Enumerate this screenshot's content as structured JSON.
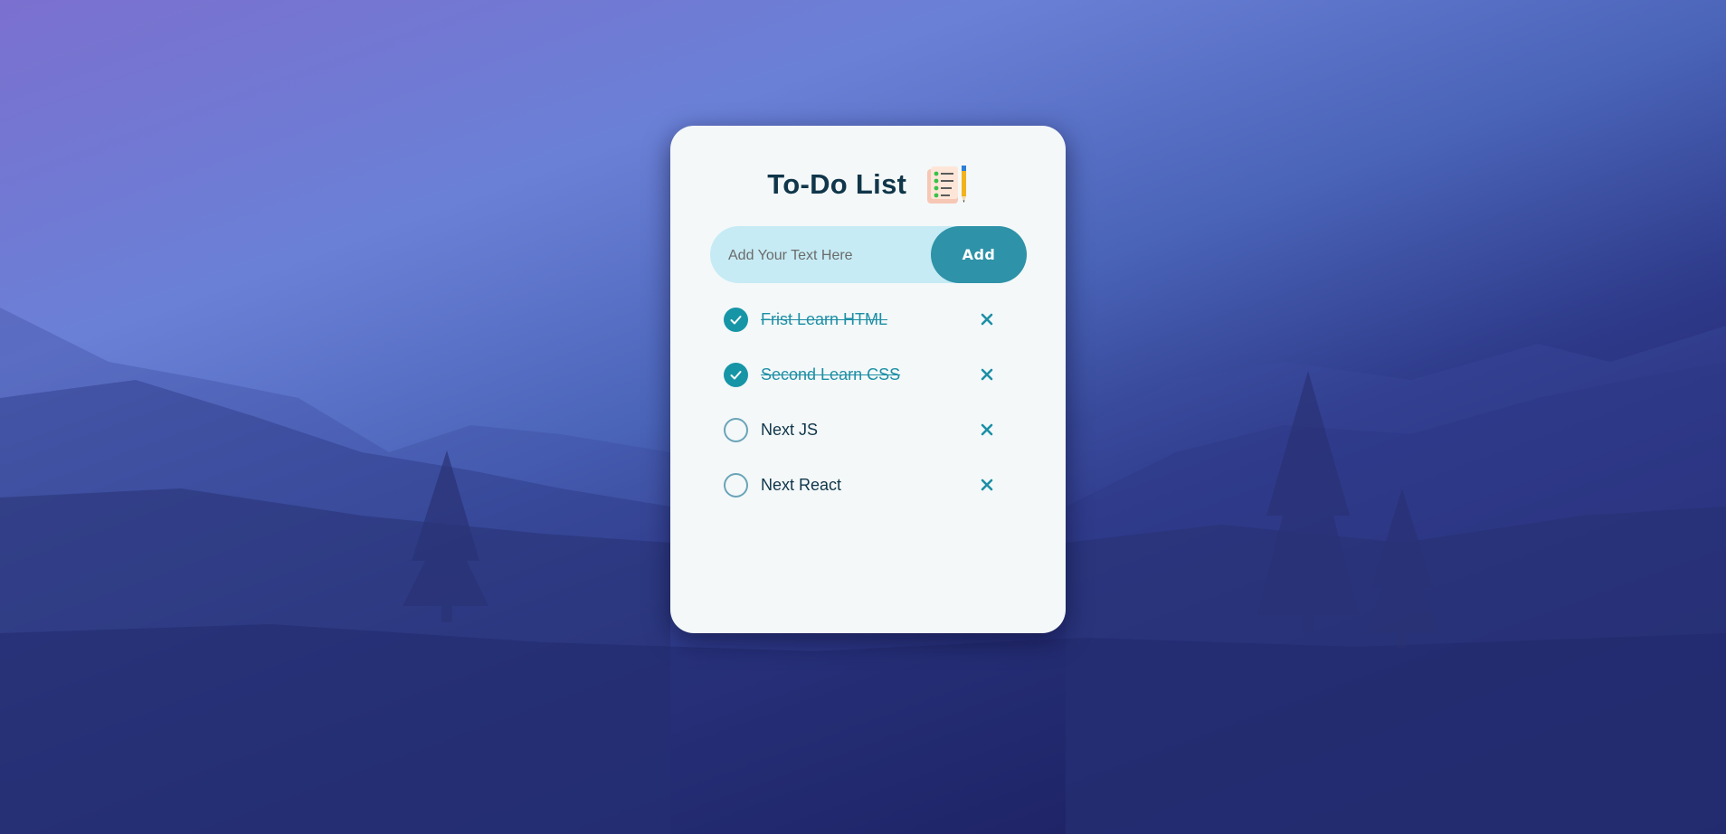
{
  "app": {
    "title": "To-Do List",
    "title_icon": "notepad-pencil-icon"
  },
  "input": {
    "value": "",
    "placeholder": "Add Your Text Here"
  },
  "add_button": {
    "label": "Add"
  },
  "tasks": [
    {
      "text": "Frist Learn HTML",
      "completed": true
    },
    {
      "text": "Second Learn CSS",
      "completed": true
    },
    {
      "text": "Next JS",
      "completed": false
    },
    {
      "text": "Next React",
      "completed": false
    }
  ],
  "colors": {
    "accent": "#2e92a8",
    "checked": "#1695a7",
    "title": "#10364a",
    "input_bg": "#c6ebf4",
    "card_bg": "#f4f8f9"
  }
}
